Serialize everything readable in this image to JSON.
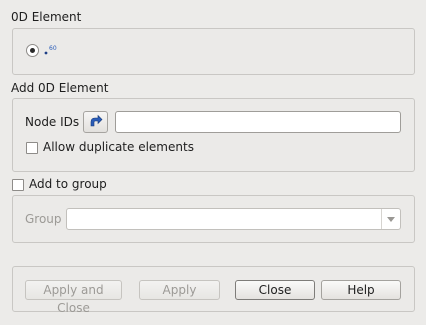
{
  "element_type": {
    "title": "0D Element",
    "option_icon": "0d-element-icon",
    "option_selected": true
  },
  "add_section": {
    "title": "Add 0D Element",
    "node_ids_label": "Node IDs",
    "node_ids_value": "",
    "select_icon": "selection-arrow-icon",
    "allow_duplicates_label": "Allow duplicate elements",
    "allow_duplicates_checked": false
  },
  "group": {
    "add_to_group_label": "Add to group",
    "add_to_group_checked": false,
    "group_label": "Group",
    "group_value": ""
  },
  "buttons": {
    "apply_close": "Apply and Close",
    "apply": "Apply",
    "close": "Close",
    "help": "Help"
  },
  "colors": {
    "background": "#ecebe9",
    "icon_blue": "#2a5cb8"
  }
}
